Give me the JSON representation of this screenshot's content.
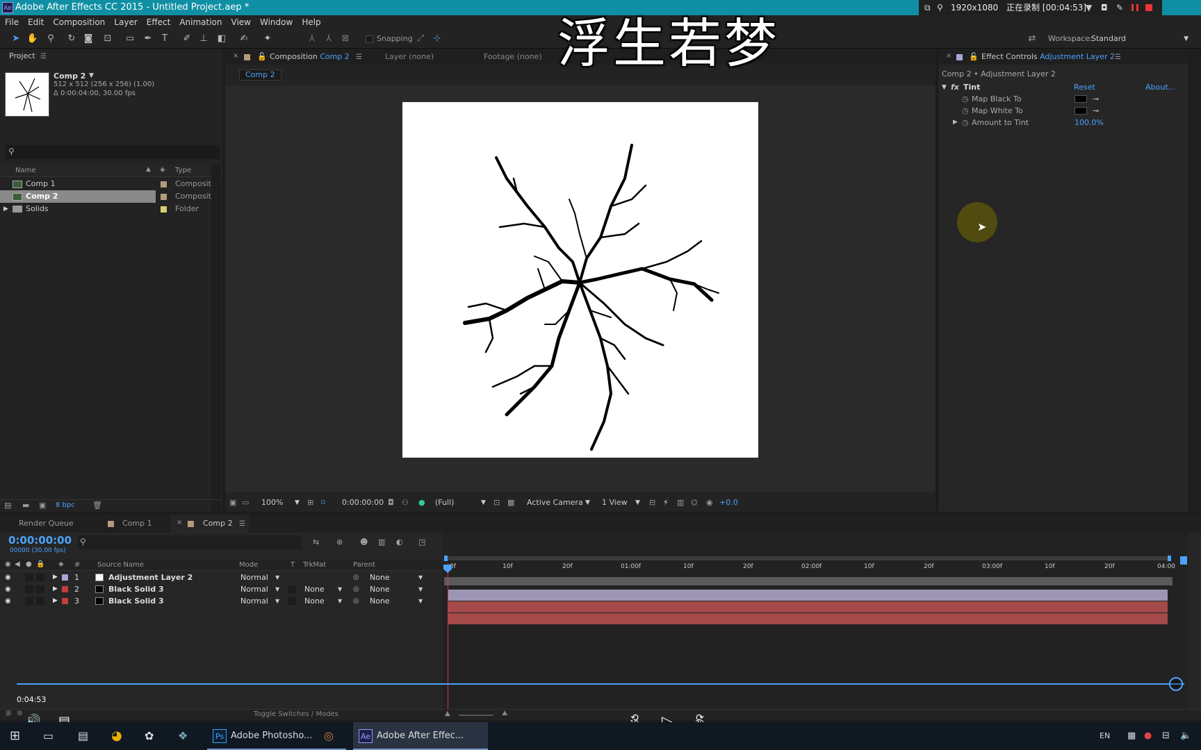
{
  "app": {
    "title": "Adobe After Effects CC 2015 - Untitled Project.aep *",
    "logo": "Ae"
  },
  "recorder": {
    "resolution": "1920x1080",
    "status": "正在录制 [00:04:53]"
  },
  "overlay_caption": "浮生若梦",
  "menu": [
    "File",
    "Edit",
    "Composition",
    "Layer",
    "Effect",
    "Animation",
    "View",
    "Window",
    "Help"
  ],
  "toolbar": {
    "snapping_label": "Snapping",
    "workspace_label": "Workspace:",
    "workspace_value": "Standard"
  },
  "project": {
    "panel_title": "Project",
    "selected_name": "Comp 2",
    "selected_info_1": "512 x 512  (256 x 256) (1.00)",
    "selected_info_2": "Δ 0:00:04:00, 30.00 fps",
    "col_name": "Name",
    "col_type": "Type",
    "items": [
      {
        "name": "Comp 1",
        "type": "Composit",
        "label_color": "#b49b7c"
      },
      {
        "name": "Comp 2",
        "type": "Composit",
        "label_color": "#b49b7c"
      },
      {
        "name": "Solids",
        "type": "Folder",
        "label_color": "#d8d070"
      }
    ],
    "bpc": "8 bpc"
  },
  "viewer": {
    "tab_composition": "Composition",
    "tab_comp_name": "Comp 2",
    "tab_layer": "Layer (none)",
    "tab_footage": "Footage (none)",
    "breadcrumb": "Comp 2",
    "zoom": "100%",
    "timecode": "0:00:00:00",
    "resolution": "(Full)",
    "camera": "Active Camera",
    "views": "1 View",
    "exposure": "+0.0"
  },
  "effect_controls": {
    "tab_label": "Effect Controls",
    "tab_layer": "Adjustment Layer 2",
    "path": "Comp 2 • Adjustment Layer 2",
    "effect_name": "Tint",
    "reset": "Reset",
    "about": "About...",
    "props": [
      {
        "name": "Map Black To",
        "swatch": "#000000"
      },
      {
        "name": "Map White To",
        "swatch": "#000000"
      }
    ],
    "amount_label": "Amount to Tint",
    "amount_value": "100.0%"
  },
  "timeline": {
    "tabs": [
      "Render Queue",
      "Comp 1",
      "Comp 2"
    ],
    "timecode": "0:00:00:00",
    "frames": "00000 (30.00 fps)",
    "col_source": "Source Name",
    "col_mode": "Mode",
    "col_t": "T",
    "col_trkmat": "TrkMat",
    "col_parent": "Parent",
    "ruler": [
      "0f",
      "10f",
      "20f",
      "01:00f",
      "10f",
      "20f",
      "02:00f",
      "10f",
      "20f",
      "03:00f",
      "10f",
      "20f",
      "04:00"
    ],
    "layers": [
      {
        "num": "1",
        "name": "Adjustment Layer 2",
        "mode": "Normal",
        "trkmat": "",
        "parent": "None",
        "label": "#a7a7d8",
        "swatch": "#ffffff",
        "bar": "#9c95b3"
      },
      {
        "num": "2",
        "name": "Black Solid 3",
        "mode": "Normal",
        "trkmat": "None",
        "parent": "None",
        "label": "#c43d3d",
        "swatch": "#000000",
        "bar": "#a44a4a"
      },
      {
        "num": "3",
        "name": "Black Solid 3",
        "mode": "Normal",
        "trkmat": "None",
        "parent": "None",
        "label": "#c43d3d",
        "swatch": "#000000",
        "bar": "#a44a4a"
      }
    ],
    "toggle_label": "Toggle Switches / Modes"
  },
  "player": {
    "elapsed": "0:04:53",
    "progress": 1.0,
    "back_label": "10",
    "fwd_label": "30"
  },
  "taskbar": {
    "items": [
      {
        "label": "Adobe Photosho...",
        "logo": "Ps"
      },
      {
        "label": "Adobe After Effec...",
        "logo": "Ae"
      }
    ],
    "lang": "EN"
  }
}
